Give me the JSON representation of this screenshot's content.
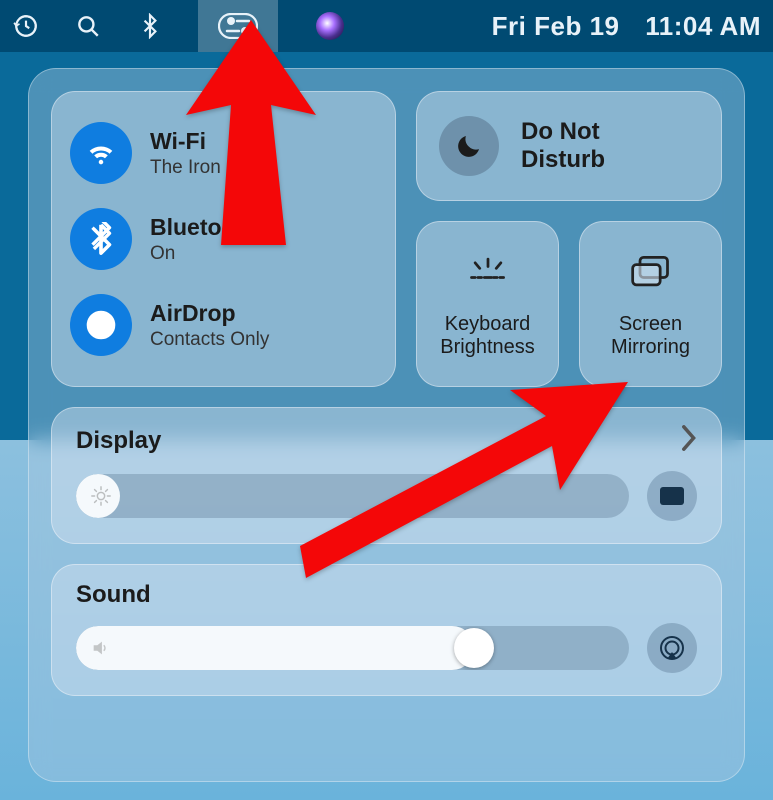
{
  "menubar": {
    "date": "Fri Feb 19",
    "time": "11:04 AM"
  },
  "connectivity": {
    "wifi": {
      "title": "Wi-Fi",
      "sub": "The Iron Dome"
    },
    "bluetooth": {
      "title": "Bluetooth",
      "sub": "On"
    },
    "airdrop": {
      "title": "AirDrop",
      "sub": "Contacts Only"
    }
  },
  "dnd": {
    "label_l1": "Do Not",
    "label_l2": "Disturb"
  },
  "keyboard_brightness": {
    "label_l1": "Keyboard",
    "label_l2": "Brightness"
  },
  "screen_mirroring": {
    "label_l1": "Screen",
    "label_l2": "Mirroring"
  },
  "display": {
    "title": "Display",
    "level_pct": 5
  },
  "sound": {
    "title": "Sound",
    "level_pct": 72
  }
}
